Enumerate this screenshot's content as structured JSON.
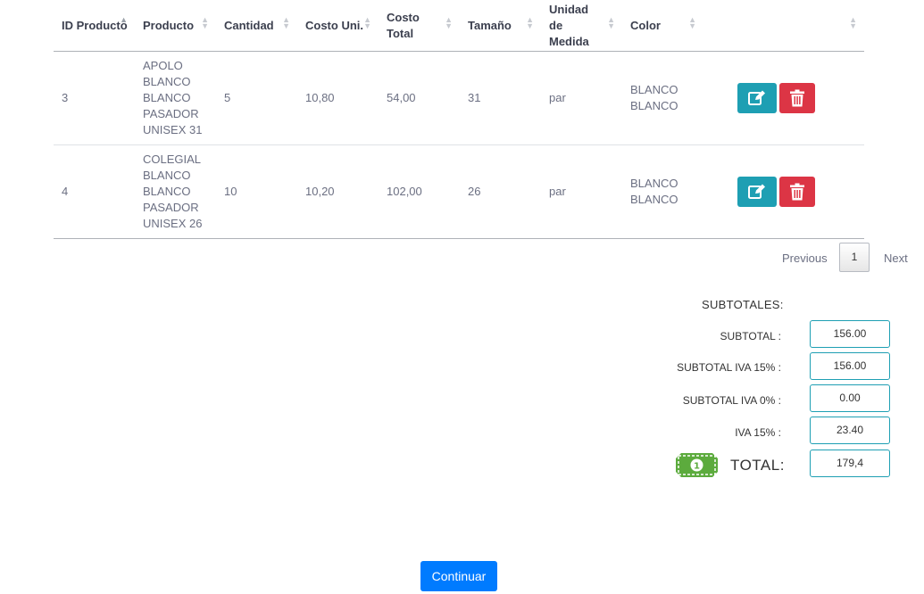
{
  "table": {
    "columns": [
      "ID Producto",
      "Producto",
      "Cantidad",
      "Costo Uni.",
      "Costo Total",
      "Tamaño",
      "Unidad de Medida",
      "Color",
      ""
    ],
    "rows": [
      {
        "id": "3",
        "producto": "APOLO BLANCO BLANCO PASADOR UNISEX 31",
        "cantidad": "5",
        "costo_uni": "10,80",
        "costo_total": "54,00",
        "tamano": "31",
        "unidad": "par",
        "color": "BLANCO BLANCO"
      },
      {
        "id": "4",
        "producto": "COLEGIAL BLANCO BLANCO PASADOR UNISEX 26",
        "cantidad": "10",
        "costo_uni": "10,20",
        "costo_total": "102,00",
        "tamano": "26",
        "unidad": "par",
        "color": "BLANCO BLANCO"
      }
    ]
  },
  "pagination": {
    "previous": "Previous",
    "current": "1",
    "next": "Next"
  },
  "totals": {
    "heading": "SUBTOTALES:",
    "subtotal_label": "SUBTOTAL :",
    "subtotal_value": "156.00",
    "iva15_label": "SUBTOTAL IVA 15% :",
    "iva15_value": "156.00",
    "iva0_label": "SUBTOTAL IVA 0% :",
    "iva0_value": "0.00",
    "iva_label": "IVA 15% :",
    "iva_value": "23.40",
    "total_label": "TOTAL:",
    "total_value": "179,4"
  },
  "icons": {
    "edit": "pencil-square-icon",
    "delete": "trash-icon",
    "money": "money-bill-icon"
  },
  "colors": {
    "edit_button": "#1e9fb3",
    "delete_button": "#dc3545",
    "primary": "#007bff",
    "money": "#5cab3d"
  },
  "continue_label": "Continuar"
}
